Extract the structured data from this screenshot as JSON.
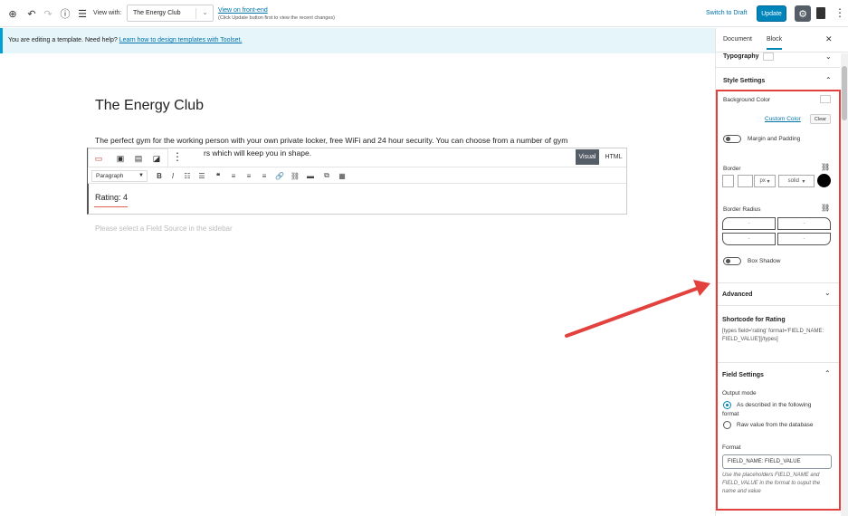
{
  "toolbar": {
    "view_with_label": "View with:",
    "view_with_value": "The Energy Club",
    "front_end_link": "View on front-end",
    "front_end_note": "(Click Update button first to view the recent changes)",
    "switch_to_draft": "Switch to Draft",
    "update": "Update"
  },
  "notice": {
    "text": "You are editing a template. Need help?",
    "link": "Learn how to design templates with Toolset."
  },
  "editor": {
    "title": "The Energy Club",
    "paragraph_line1": "The perfect gym for the working person with your own private locker, free WiFi and 24 hour security. You can choose from a number of gym",
    "paragraph_line2": "rs which will keep you in shape.",
    "tab_visual": "Visual",
    "tab_html": "HTML",
    "format_select": "Paragraph",
    "rating": "Rating: 4",
    "placeholder": "Please select a Field Source in the sidebar"
  },
  "sidebar": {
    "tab_document": "Document",
    "tab_block": "Block",
    "typography": "Typography",
    "style_settings": "Style Settings",
    "background_color": "Background Color",
    "custom_color": "Custom Color",
    "clear": "Clear",
    "margin_padding": "Margin and Padding",
    "border": "Border",
    "border_unit": "px",
    "border_style": "solid",
    "border_radius": "Border Radius",
    "radius_placeholder": "-",
    "box_shadow": "Box Shadow",
    "advanced": "Advanced",
    "shortcode_title": "Shortcode for Rating",
    "shortcode": "[types field='rating' format='FIELD_NAME: FIELD_VALUE'][/types]",
    "field_settings": "Field Settings",
    "output_mode": "Output mode",
    "option_format_a": "As described in the following",
    "option_format_b": "format",
    "option_raw": "Raw value from the database",
    "format_label": "Format",
    "format_value": "FIELD_NAME: FIELD_VALUE",
    "help": "Use the placeholders FIELD_NAME and FIELD_VALUE in the format to ouput the name and value"
  },
  "colors": {
    "accent": "#0085ba",
    "highlight": "#e2413e",
    "notice_bg": "#e5f5fa"
  }
}
